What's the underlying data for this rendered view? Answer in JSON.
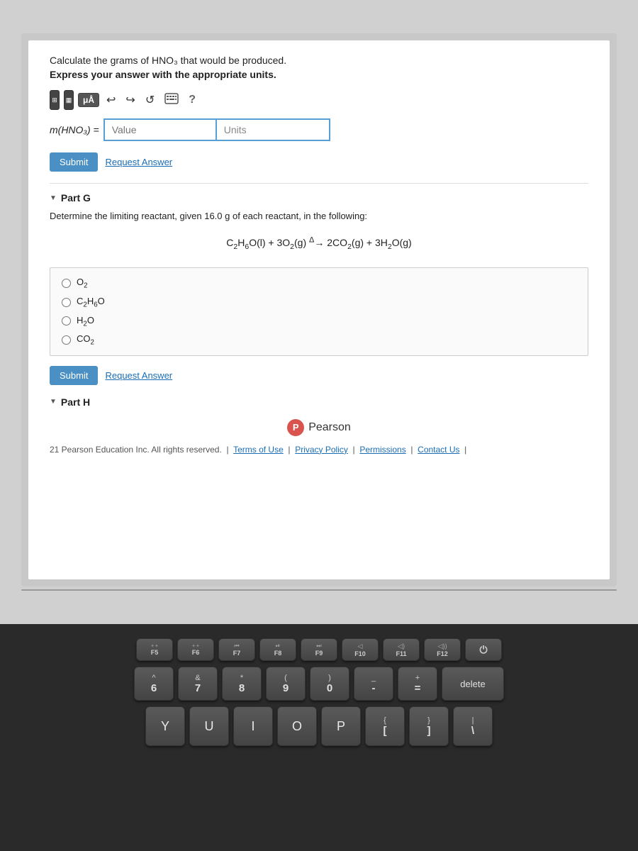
{
  "page": {
    "question_line1": "Calculate the grams of HNO₃ that would be produced.",
    "question_line2": "Express your answer with the appropriate units.",
    "answer_label": "m(HNO₃) =",
    "value_placeholder": "Value",
    "units_placeholder": "Units",
    "submit_label": "Submit",
    "request_answer_label": "Request Answer",
    "part_g_label": "Part G",
    "part_g_question": "Determine the limiting reactant, given 16.0 g of each reactant, in the following:",
    "equation": "C₂H₆O(l) + 3O₂(g) → 2CO₂(g) + 3H₂O(g)",
    "radio_options": [
      {
        "id": "opt1",
        "label": "O₂"
      },
      {
        "id": "opt2",
        "label": "C₂H₆O"
      },
      {
        "id": "opt3",
        "label": "H₂O"
      },
      {
        "id": "opt4",
        "label": "CO₂"
      }
    ],
    "part_h_label": "Part H",
    "pearson_logo_text": "Pearson",
    "footer_text": "21 Pearson Education Inc. All rights reserved.",
    "footer_links": [
      "Terms of Use",
      "Privacy Policy",
      "Permissions",
      "Contact Us"
    ],
    "toolbar": {
      "mu_label": "μÅ",
      "undo_label": "↩",
      "redo_label": "↪",
      "reset_label": "↺",
      "keyboard_label": "⌨",
      "help_label": "?"
    },
    "keyboard": {
      "fn_row": [
        {
          "top": "",
          "bot": "F5"
        },
        {
          "top": "",
          "bot": "F6"
        },
        {
          "top": "⏮",
          "bot": "F7"
        },
        {
          "top": "⏯",
          "bot": "F8"
        },
        {
          "top": "⏭",
          "bot": "F9"
        },
        {
          "top": "◁",
          "bot": "F10"
        },
        {
          "top": "◁)",
          "bot": "F11"
        },
        {
          "top": "◁))",
          "bot": "F12"
        },
        {
          "top": "",
          "bot": "⏻"
        }
      ],
      "num_row": [
        {
          "sym": "^",
          "num": "6"
        },
        {
          "sym": "&",
          "num": "7"
        },
        {
          "sym": "*",
          "num": "8"
        },
        {
          "sym": "(",
          "num": "9"
        },
        {
          "sym": ")",
          "num": "0"
        },
        {
          "sym": "_",
          "num": "-"
        },
        {
          "sym": "+",
          "num": "="
        },
        {
          "sym": "",
          "num": "delete"
        }
      ],
      "letter_row1": [
        "Y",
        "U",
        "I",
        "O",
        "P"
      ],
      "letter_row2": []
    }
  }
}
